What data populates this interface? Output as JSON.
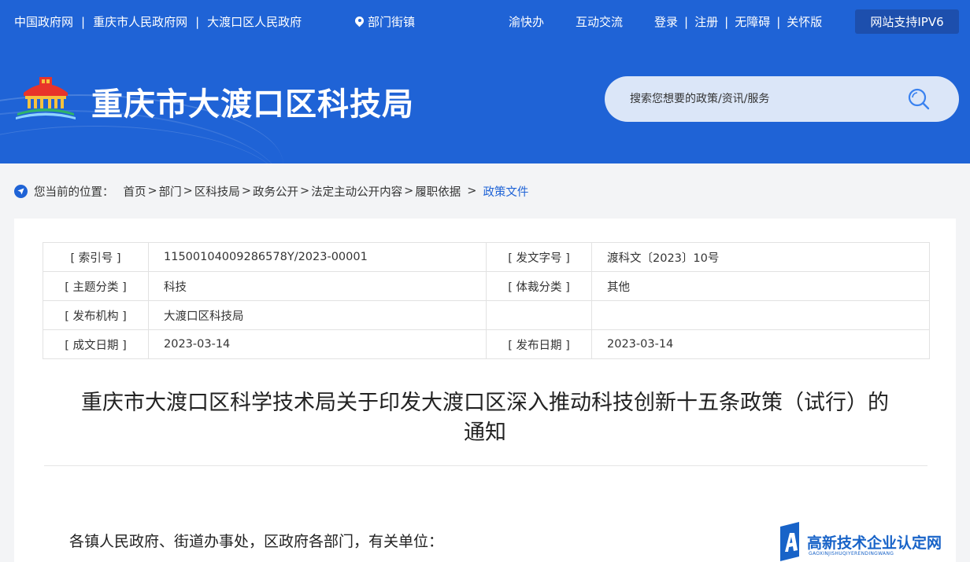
{
  "top_nav": {
    "left_links": [
      "中国政府网",
      "重庆市人民政府网",
      "大渡口区人民政府"
    ],
    "dept_link": "部门街镇",
    "app_links": [
      "渝快办",
      "互动交流"
    ],
    "account_links": [
      "登录",
      "注册",
      "无障碍",
      "关怀版"
    ],
    "ipv6_badge": "网站支持IPV6"
  },
  "site": {
    "title": "重庆市大渡口区科技局"
  },
  "search": {
    "placeholder": "搜索您想要的政策/资讯/服务"
  },
  "breadcrumb": {
    "label": "您当前的位置：",
    "items": [
      "首页",
      "部门",
      "区科技局",
      "政务公开",
      "法定主动公开内容",
      "履职依据"
    ],
    "current": "政策文件"
  },
  "meta_table": [
    [
      "[ 索引号 ]",
      "11500104009286578Y/2023-00001",
      "[ 发文字号 ]",
      "渡科文〔2023〕10号"
    ],
    [
      "[ 主题分类 ]",
      "科技",
      "[ 体裁分类 ]",
      "其他"
    ],
    [
      "[ 发布机构 ]",
      "大渡口区科技局",
      "",
      ""
    ],
    [
      "[ 成文日期 ]",
      "2023-03-14",
      "[ 发布日期 ]",
      "2023-03-14"
    ]
  ],
  "document": {
    "title_line1": "重庆市大渡口区科学技术局关于印发大渡口区深入推动科技创新十五条政策（试行）的",
    "title_line2": "通知",
    "salutation": "各镇人民政府、街道办事处，区政府各部门，有关单位："
  },
  "watermark": {
    "text": "高新技术企业认定网",
    "subtext": "GAOXINJISHUQIYERENDINGWANG"
  },
  "colors": {
    "header_blue": "#1f63d6",
    "ipv6_bg": "#1d4fad",
    "search_bg": "#dbe6f8",
    "link_active": "#1f63d6"
  }
}
